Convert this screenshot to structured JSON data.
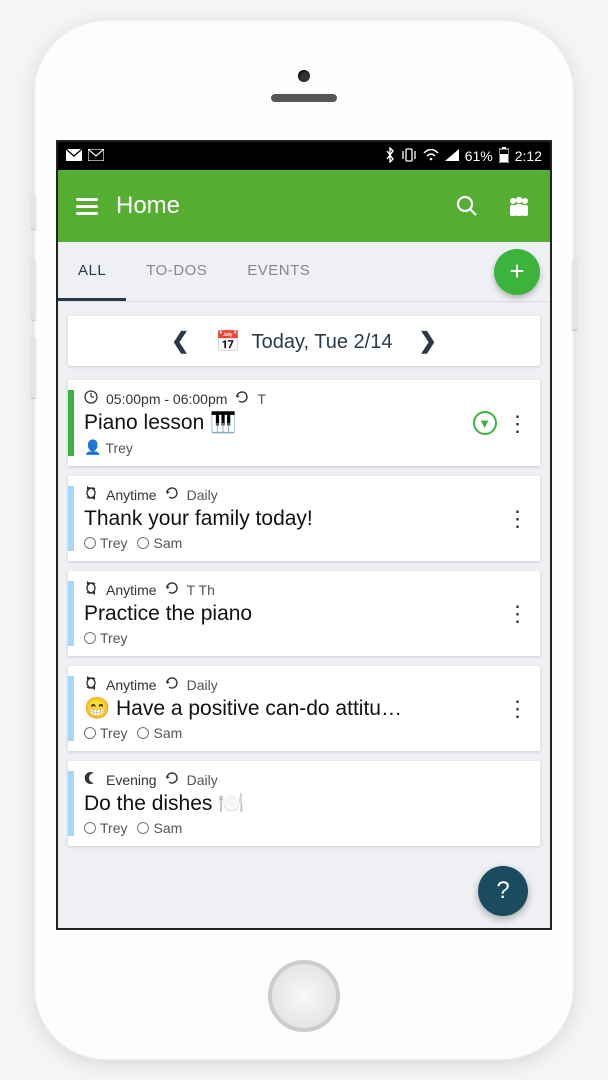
{
  "status": {
    "battery_pct": "61%",
    "time": "2:12"
  },
  "appbar": {
    "title": "Home"
  },
  "tabs": {
    "all": "ALL",
    "todos": "TO-DOS",
    "events": "EVENTS"
  },
  "fab": {
    "plus": "+"
  },
  "date_nav": {
    "label": "Today, Tue 2/14"
  },
  "cards": [
    {
      "stripe": "green",
      "time": "05:00pm - 06:00pm",
      "repeat": "T",
      "title": "Piano lesson 🎹",
      "assignees_person": "Trey",
      "has_expand": true
    },
    {
      "when": "Anytime",
      "repeat": "Daily",
      "title": "Thank your family today!",
      "a1": "Trey",
      "a2": "Sam"
    },
    {
      "when": "Anytime",
      "repeat": "T Th",
      "title": "Practice the piano",
      "a1": "Trey"
    },
    {
      "when": "Anytime",
      "repeat": "Daily",
      "title": "😁 Have a positive can-do attitu…",
      "a1": "Trey",
      "a2": "Sam"
    },
    {
      "when": "Evening",
      "repeat": "Daily",
      "title": "Do the dishes 🍽️",
      "a1": "Trey",
      "a2": "Sam"
    }
  ],
  "help": "?"
}
